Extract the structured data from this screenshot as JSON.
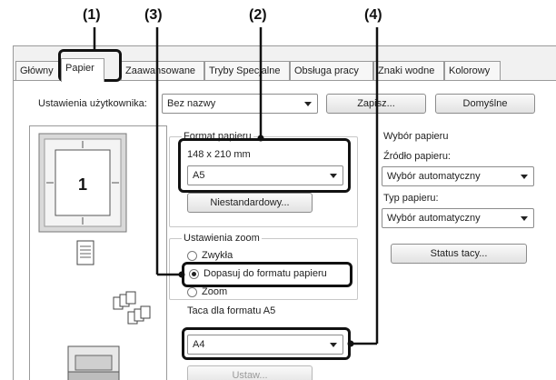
{
  "callouts": [
    "(1)",
    "(3)",
    "(2)",
    "(4)"
  ],
  "tabs": [
    "Główny",
    "Papier",
    "Zaawansowane",
    "Tryby Specjalne",
    "Obsługa pracy",
    "Znaki wodne",
    "Kolorowy"
  ],
  "settings_row": {
    "label": "Ustawienia użytkownika:",
    "value": "Bez nazwy",
    "save": "Zapisz...",
    "defaults": "Domyślne"
  },
  "preview": {
    "page_number": "1"
  },
  "paper_size": {
    "title": "Format papieru",
    "dimensions": "148 x 210 mm",
    "value": "A5",
    "custom_button": "Niestandardowy..."
  },
  "zoom": {
    "title": "Ustawienia zoom",
    "options": [
      "Zwykła",
      "Dopasuj do formatu papieru",
      "Zoom"
    ],
    "selected": "Dopasuj do formatu papieru"
  },
  "fit_tray": {
    "label": "Taca dla formatu A5",
    "value": "A4",
    "set_button": "Ustaw..."
  },
  "paper_selection": {
    "title": "Wybór papieru",
    "source_label": "Źródło papieru:",
    "source_value": "Wybór automatyczny",
    "type_label": "Typ papieru:",
    "type_value": "Wybór automatyczny",
    "tray_status_button": "Status tacy..."
  }
}
